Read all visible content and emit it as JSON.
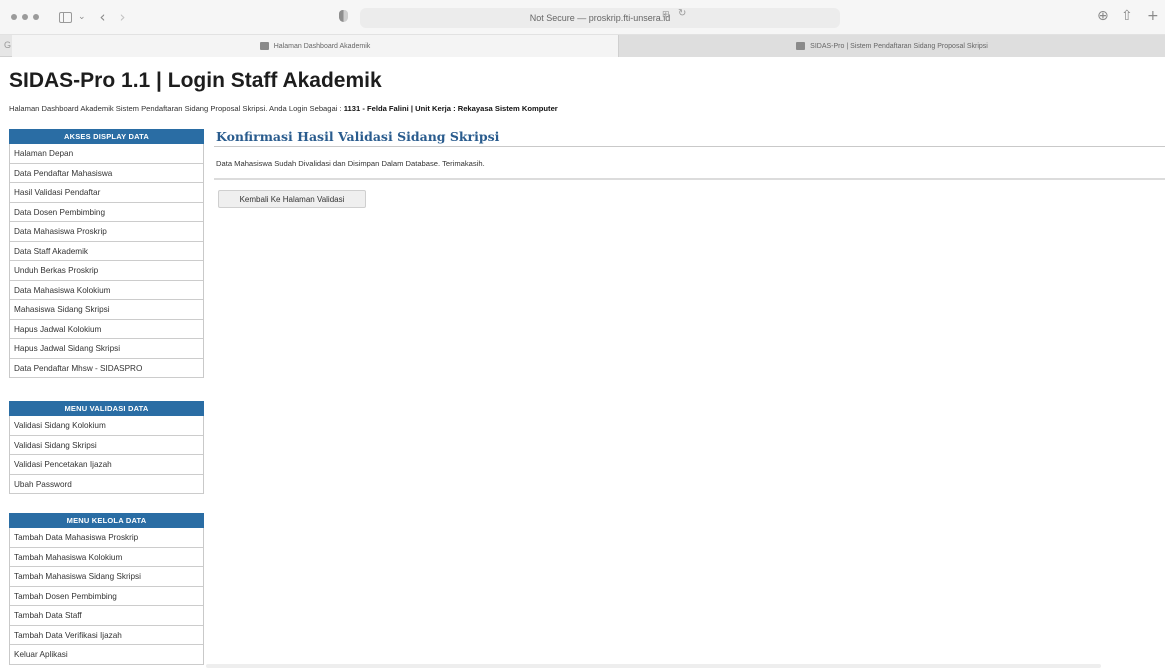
{
  "browser": {
    "address_text": "Not Secure — proskrip.fti-unsera.id",
    "tabs": [
      {
        "label": "Halaman Dashboard Akademik"
      },
      {
        "label": "SIDAS-Pro | Sistem Pendaftaran Sidang Proposal Skripsi"
      }
    ]
  },
  "page": {
    "title": "SIDAS-Pro 1.1  |  Login Staff Akademik",
    "info_prefix": "Halaman Dashboard Akademik Sistem Pendaftaran Sidang Proposal Skripsi. Anda Login Sebagai : ",
    "info_user": "1131 - Felda Falini",
    "info_sep": " | ",
    "info_unit": "Unit Kerja : Rekayasa Sistem Komputer"
  },
  "sidebar": {
    "sections": [
      {
        "heading": "AKSES DISPLAY DATA",
        "items": [
          "Halaman Depan",
          "Data Pendaftar Mahasiswa",
          "Hasil Validasi Pendaftar",
          "Data Dosen Pembimbing",
          "Data Mahasiswa Proskrip",
          "Data Staff Akademik",
          "Unduh Berkas Proskrip",
          "Data Mahasiswa Kolokium",
          "Mahasiswa Sidang Skripsi",
          "Hapus Jadwal Kolokium",
          "Hapus Jadwal Sidang Skripsi",
          "Data Pendaftar Mhsw - SIDASPRO"
        ]
      },
      {
        "heading": "MENU VALIDASI DATA",
        "items": [
          "Validasi Sidang Kolokium",
          "Validasi Sidang Skripsi",
          "Validasi Pencetakan Ijazah",
          "Ubah Password"
        ]
      },
      {
        "heading": "MENU KELOLA DATA",
        "items": [
          "Tambah Data Mahasiswa Proskrip",
          "Tambah Mahasiswa Kolokium",
          "Tambah Mahasiswa Sidang Skripsi",
          "Tambah Dosen Pembimbing",
          "Tambah Data Staff",
          "Tambah Data Verifikasi Ijazah",
          "Keluar Aplikasi"
        ]
      }
    ]
  },
  "main": {
    "heading": "Konfirmasi Hasil Validasi Sidang Skripsi",
    "message": "Data Mahasiswa Sudah Divalidasi dan Disimpan Dalam Database. Terimakasih.",
    "back_button": "Kembali Ke Halaman Validasi"
  }
}
